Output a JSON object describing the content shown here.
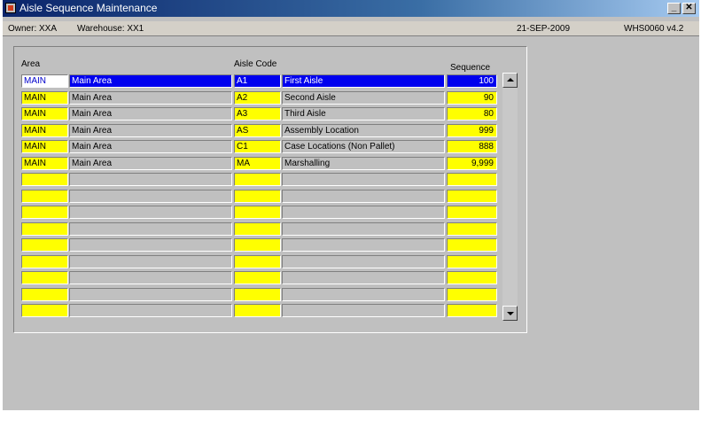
{
  "window": {
    "title": "Aisle Sequence Maintenance",
    "minimize_label": "_",
    "close_label": "✕"
  },
  "status": {
    "owner": "Owner: XXA",
    "warehouse": "Warehouse: XX1",
    "date": "21-SEP-2009",
    "module": "WHS0060 v4.2"
  },
  "columns": {
    "area": "Area",
    "aisle_code": "Aisle Code",
    "sequence": "Sequence"
  },
  "rows": [
    {
      "area": "MAIN",
      "area_desc": "Main Area",
      "code": "A1",
      "aisle_desc": "First Aisle",
      "sequence": "100"
    },
    {
      "area": "MAIN",
      "area_desc": "Main Area",
      "code": "A2",
      "aisle_desc": "Second Aisle",
      "sequence": "90"
    },
    {
      "area": "MAIN",
      "area_desc": "Main Area",
      "code": "A3",
      "aisle_desc": "Third Aisle",
      "sequence": "80"
    },
    {
      "area": "MAIN",
      "area_desc": "Main Area",
      "code": "AS",
      "aisle_desc": "Assembly Location",
      "sequence": "999"
    },
    {
      "area": "MAIN",
      "area_desc": "Main Area",
      "code": "C1",
      "aisle_desc": "Case Locations (Non Pallet)",
      "sequence": "888"
    },
    {
      "area": "MAIN",
      "area_desc": "Main Area",
      "code": "MA",
      "aisle_desc": "Marshalling",
      "sequence": "9,999"
    },
    {
      "area": "",
      "area_desc": "",
      "code": "",
      "aisle_desc": "",
      "sequence": ""
    },
    {
      "area": "",
      "area_desc": "",
      "code": "",
      "aisle_desc": "",
      "sequence": ""
    },
    {
      "area": "",
      "area_desc": "",
      "code": "",
      "aisle_desc": "",
      "sequence": ""
    },
    {
      "area": "",
      "area_desc": "",
      "code": "",
      "aisle_desc": "",
      "sequence": ""
    },
    {
      "area": "",
      "area_desc": "",
      "code": "",
      "aisle_desc": "",
      "sequence": ""
    },
    {
      "area": "",
      "area_desc": "",
      "code": "",
      "aisle_desc": "",
      "sequence": ""
    },
    {
      "area": "",
      "area_desc": "",
      "code": "",
      "aisle_desc": "",
      "sequence": ""
    },
    {
      "area": "",
      "area_desc": "",
      "code": "",
      "aisle_desc": "",
      "sequence": ""
    },
    {
      "area": "",
      "area_desc": "",
      "code": "",
      "aisle_desc": "",
      "sequence": ""
    }
  ],
  "selected_row": 0,
  "colors": {
    "field_bg": "#ffff00",
    "desc_bg": "#c0c0c0",
    "selection": "#0000ee"
  },
  "icons": {
    "app": "oracle-forms-icon",
    "scroll_up": "up-arrow-icon",
    "scroll_down": "down-arrow-icon"
  }
}
